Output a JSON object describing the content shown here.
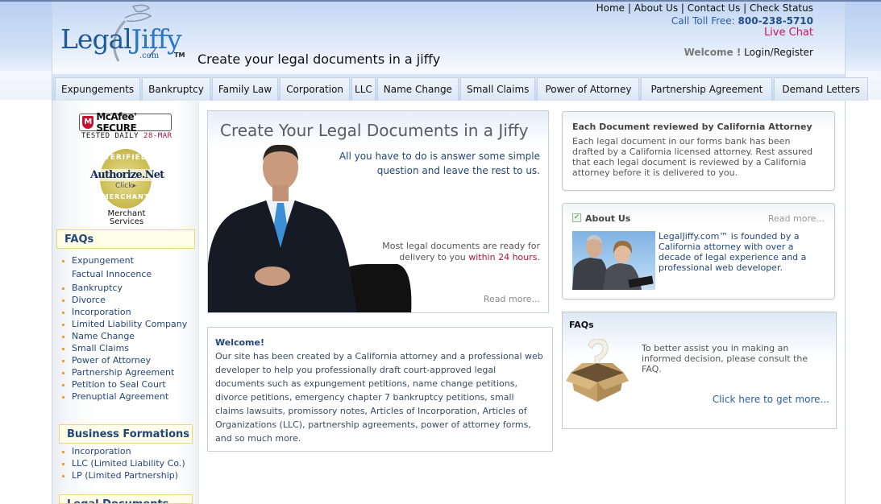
{
  "header": {
    "logo": {
      "main": "Legal",
      "accent": "Jiffy",
      "domain": ".com",
      "tm": "TM"
    },
    "tagline": "Create your legal documents in a jiffy",
    "top_links": [
      "Home",
      "About Us",
      "Contact Us",
      "Check Status"
    ],
    "separator": "|",
    "toll_free_label": "Call Toll Free:",
    "toll_free_number": "800-238-5710",
    "live_chat": "Live Chat",
    "welcome_label": "Welcome !",
    "login_register": "Login/Register"
  },
  "nav": {
    "items": [
      "Expungements",
      "Bankruptcy",
      "Family Law",
      "Corporation",
      "LLC",
      "Name Change",
      "Small Claims",
      "Power of Attorney",
      "Partnership Agreement",
      "Demand Letters"
    ]
  },
  "sidebar": {
    "mcafee": {
      "icon": "M",
      "brand": "McAfee' SECURE",
      "tested": "TESTED DAILY",
      "date": "28-MAR"
    },
    "authorize_net": {
      "top": "VERIFIED",
      "name": "Authorize.Net",
      "click": "Click▸",
      "bottom": "MERCHANT"
    },
    "merchant_services": [
      "Merchant",
      "Services"
    ],
    "faqs_heading": "FAQs",
    "faqs": [
      {
        "label": "Expungement",
        "sub": false
      },
      {
        "label": "Factual Innocence",
        "sub": true
      },
      {
        "label": "Bankruptcy",
        "sub": false
      },
      {
        "label": "Divorce",
        "sub": false
      },
      {
        "label": "Incorporation",
        "sub": false
      },
      {
        "label": "Limited Liability Company",
        "sub": false
      },
      {
        "label": "Name Change",
        "sub": false
      },
      {
        "label": "Small Claims",
        "sub": false
      },
      {
        "label": "Power of Attorney",
        "sub": false
      },
      {
        "label": "Partnership Agreement",
        "sub": false
      },
      {
        "label": "Petition to Seal Court",
        "sub": false
      },
      {
        "label": "Prenuptial Agreement",
        "sub": false
      }
    ],
    "business_heading": "Business Formations",
    "business": [
      "Incorporation",
      "LLC (Limited Liability Co.)",
      "LP (Limited Partnership)"
    ],
    "legal_heading": "Legal Documents"
  },
  "hero": {
    "title": "Create Your Legal Documents in a Jiffy",
    "subtitle_line1": "All you have to do is answer some simple",
    "subtitle_line2": "question and leave the rest to us.",
    "delivery_line1": "Most legal documents are ready for",
    "delivery_line2_prefix": "delivery to you ",
    "delivery_highlight": "within 24 hours.",
    "read_more": "Read more..."
  },
  "welcome": {
    "title": "Welcome!",
    "body": "Our site has been created by a California attorney and a professional web developer to help you professionally draft court-approved legal documents such as expungement petitions, name change petitions, divorce petitions, emergency chapter 7 bankruptcy petitions, small claims lawsuits, promissory notes, Articles of Incorporation, Articles of Organizations (LLC), partnership agreements, power of attorney forms, and so much more."
  },
  "review_box": {
    "title": "Each Document reviewed by California Attorney",
    "body": "Each legal document in our forms bank has been drafted by a California licensed attorney. Rest assured that each legal document is reviewed by a California attorney before it is delivered to you."
  },
  "about_box": {
    "check": "✓",
    "title": "About Us",
    "read_more": "Read more...",
    "body": "LegalJiffy.com™ is founded by a California attorney with over a decade of legal experience and a professional web developer."
  },
  "faq_box": {
    "title": "FAQs",
    "body": "To better assist you in making an informed decision, please consult the FAQ.",
    "link": "Click here to get more..."
  },
  "colors": {
    "brand_blue": "#1e5a99",
    "link_blue": "#22467a",
    "live_chat": "#d2145a",
    "highlight_red": "#b3163a",
    "bullet": "#e4a13a"
  }
}
